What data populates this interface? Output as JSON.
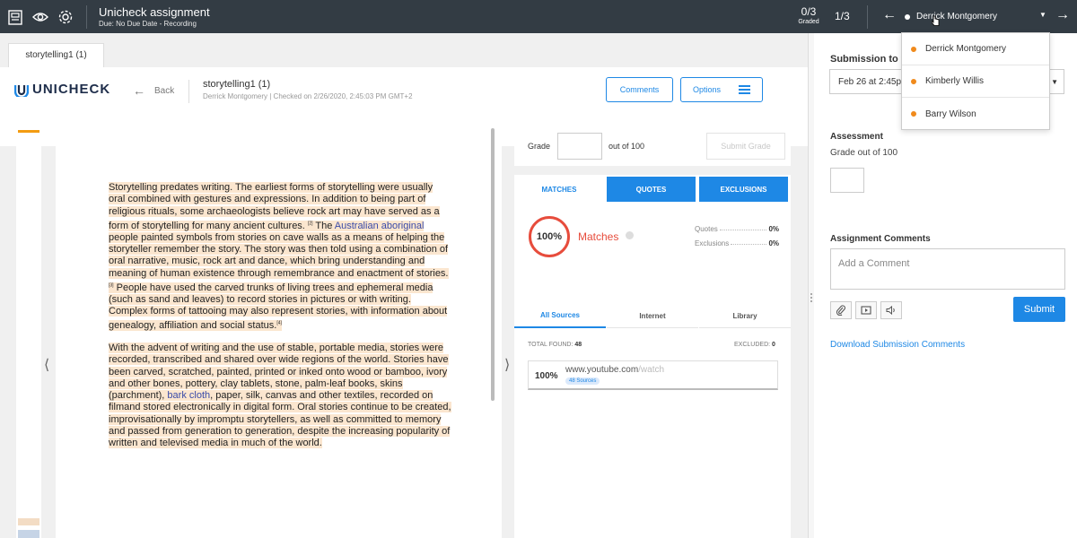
{
  "topbar": {
    "title": "Unicheck assignment",
    "subtitle": "Due: No Due Date - Recording",
    "graded_count": "0/3",
    "graded_label": "Graded",
    "position": "1/3",
    "current_student": "Derrick Montgomery",
    "icons": [
      "rubric-icon",
      "eye-icon",
      "gear-icon",
      "arrow-left-icon",
      "arrow-right-icon"
    ]
  },
  "student_dropdown": {
    "items": [
      "Derrick Montgomery",
      "Kimberly Willis",
      "Barry Wilson"
    ],
    "status_color": "#f08a1c"
  },
  "doc_tab": "storytelling1 (1)",
  "unicheck": {
    "logo": "UNICHECK",
    "back": "Back",
    "doc_title": "storytelling1 (1)",
    "doc_meta": "Derrick Montgomery | Checked on 2/26/2020, 2:45:03 PM GMT+2",
    "comments_btn": "Comments",
    "options_btn": "Options"
  },
  "document": {
    "p1": [
      {
        "t": "Storytelling predates writing. The earliest forms of storytelling were usually oral combined with gestures and expressions. In addition to being part of religious rituals, some archaeologists believe rock art may have served as a form of storytelling for many ancient cultures. "
      },
      {
        "t": "[2]",
        "sup": true
      },
      {
        "t": " The "
      },
      {
        "t": "Australian aboriginal",
        "link": true
      },
      {
        "t": " people painted symbols from stories on cave walls as a means of helping the storyteller remember the story. The story was then told using a combination of oral narrative, music, rock art and dance, which bring understanding and meaning of human existence through remembrance and enactment of stories."
      },
      {
        "t": "[3]",
        "sup": true
      },
      {
        "t": " People have used the carved trunks of living trees and ephemeral media (such as sand and leaves) to record stories in pictures or with writing. Complex forms of tattooing may also represent stories, with information about genealogy, affiliation and social status."
      },
      {
        "t": "[4]",
        "sup": true
      }
    ],
    "p2": [
      {
        "t": "With the advent of writing and the use of stable, portable media, stories were recorded, transcribed and shared over wide regions of the world. Stories have been carved, scratched, painted, printed or inked onto wood or bamboo, ivory and other bones, pottery, clay tablets, stone, palm-leaf books, skins (parchment), "
      },
      {
        "t": "bark cloth",
        "link": true
      },
      {
        "t": ", paper, silk, canvas and other textiles, recorded on filmand stored electronically in digital form. Oral stories continue to be created, improvisationally by impromptu storytellers, as well as committed to memory and passed from generation to generation, despite the increasing popularity of written and televised media in much of the world."
      }
    ],
    "highlight_color": "#fbe6cf"
  },
  "grade_card": {
    "label": "Grade",
    "out_of": "out of 100",
    "submit": "Submit Grade"
  },
  "results": {
    "tabs": [
      "MATCHES",
      "QUOTES",
      "EXCLUSIONS"
    ],
    "similarity": "100%",
    "matches_label": "Matches",
    "quotes_label": "Quotes",
    "quotes_val": "0%",
    "exclusions_label": "Exclusions",
    "exclusions_val": "0%",
    "source_tabs": [
      "All Sources",
      "Internet",
      "Library"
    ],
    "total_found_label": "TOTAL FOUND:",
    "total_found": "48",
    "excluded_label": "EXCLUDED:",
    "excluded": "0",
    "source": {
      "pct": "100%",
      "domain": "www.youtube.com",
      "path": "/watch",
      "badge": "48 Sources"
    },
    "accent": "#1e88e5",
    "match_color": "#e74c3c"
  },
  "sidebar": {
    "submission_label": "Submission to v",
    "submission_date": "Feb 26 at 2:45p",
    "assessment_heading": "Assessment",
    "grade_out_of": "Grade out of 100",
    "comments_heading": "Assignment Comments",
    "comment_placeholder": "Add a Comment",
    "submit": "Submit",
    "download": "Download Submission Comments",
    "comment_tools": [
      "paperclip-icon",
      "video-icon",
      "audio-icon"
    ]
  }
}
